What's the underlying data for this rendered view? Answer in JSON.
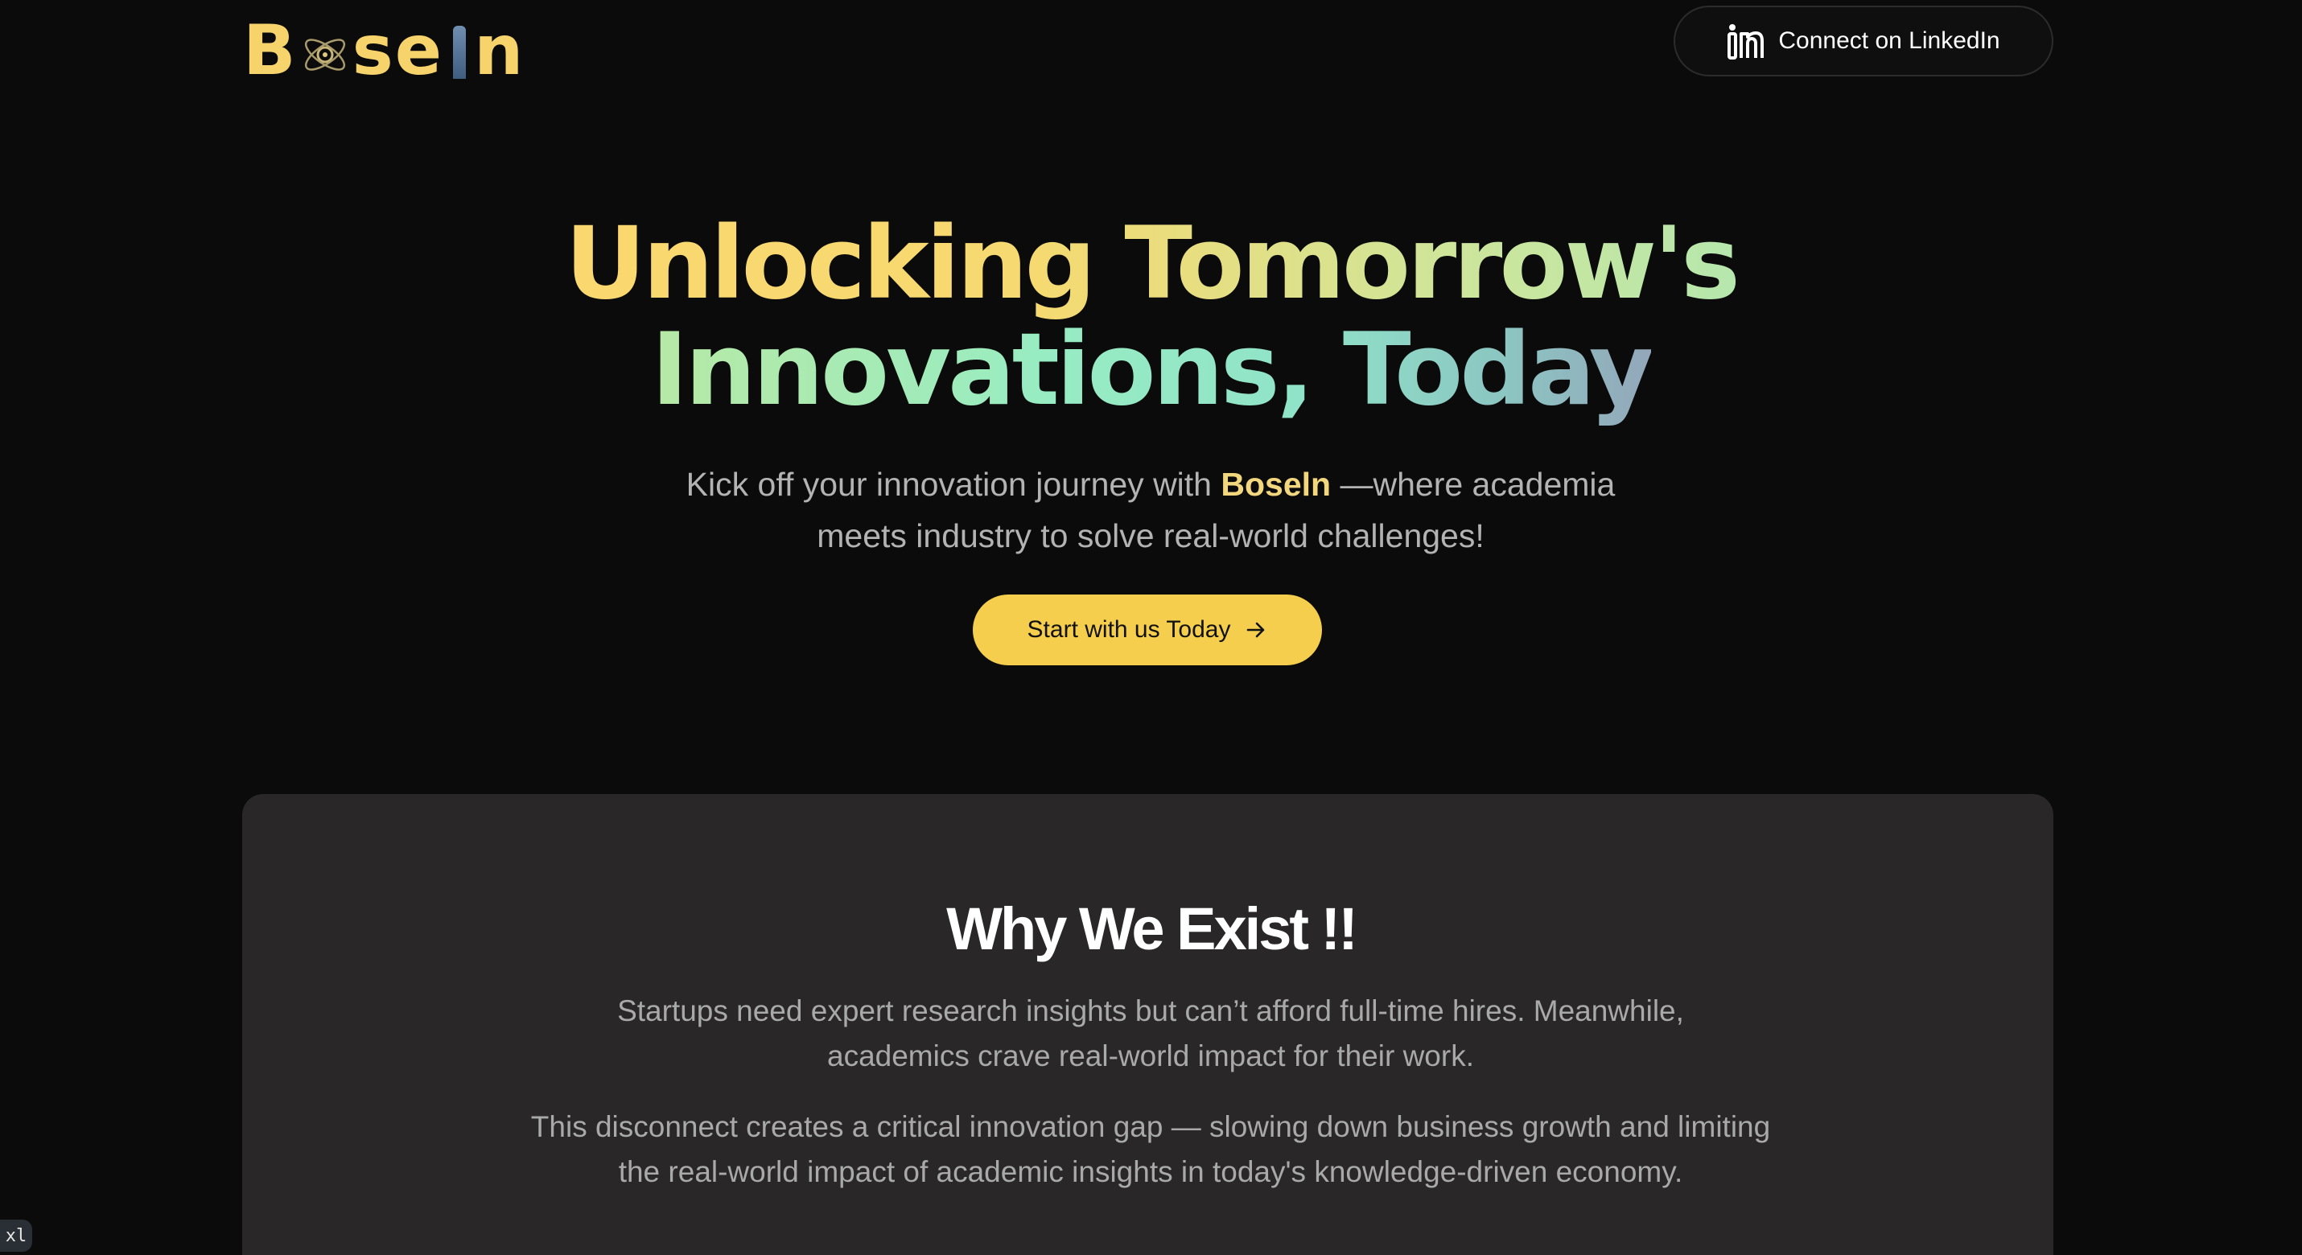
{
  "header": {
    "logo": {
      "prefix": "B",
      "middle": "se",
      "suffix": "n",
      "bar_color": "#5a7a9b",
      "atom_icon": "atom-icon"
    },
    "linkedin_button": {
      "label": "Connect on LinkedIn",
      "icon": "linkedin-icon"
    }
  },
  "hero": {
    "title_line1": "Unlocking Tomorrow's",
    "title_line2": "Innovations, Today",
    "subtitle_pre": "Kick off your innovation journey with ",
    "subtitle_brand": "Boseln",
    "subtitle_post": " —where academia meets industry to solve real-world challenges!",
    "cta_label": "Start with us Today",
    "cta_icon": "arrow-right-icon"
  },
  "why": {
    "title": "Why We Exist !!",
    "paragraph1": "Startups need expert research insights but can’t afford full-time hires. Meanwhile, academics crave real-world impact for their work.",
    "paragraph2": "This disconnect creates a critical innovation gap — slowing down business growth and limiting the real-world impact of academic insights in today's knowledge-driven economy."
  },
  "debug_badge": "xl",
  "colors": {
    "background": "#0b0b0b",
    "accent_yellow": "#f4ce4c",
    "card": "#292727",
    "brand_text": "#f3d77e"
  }
}
